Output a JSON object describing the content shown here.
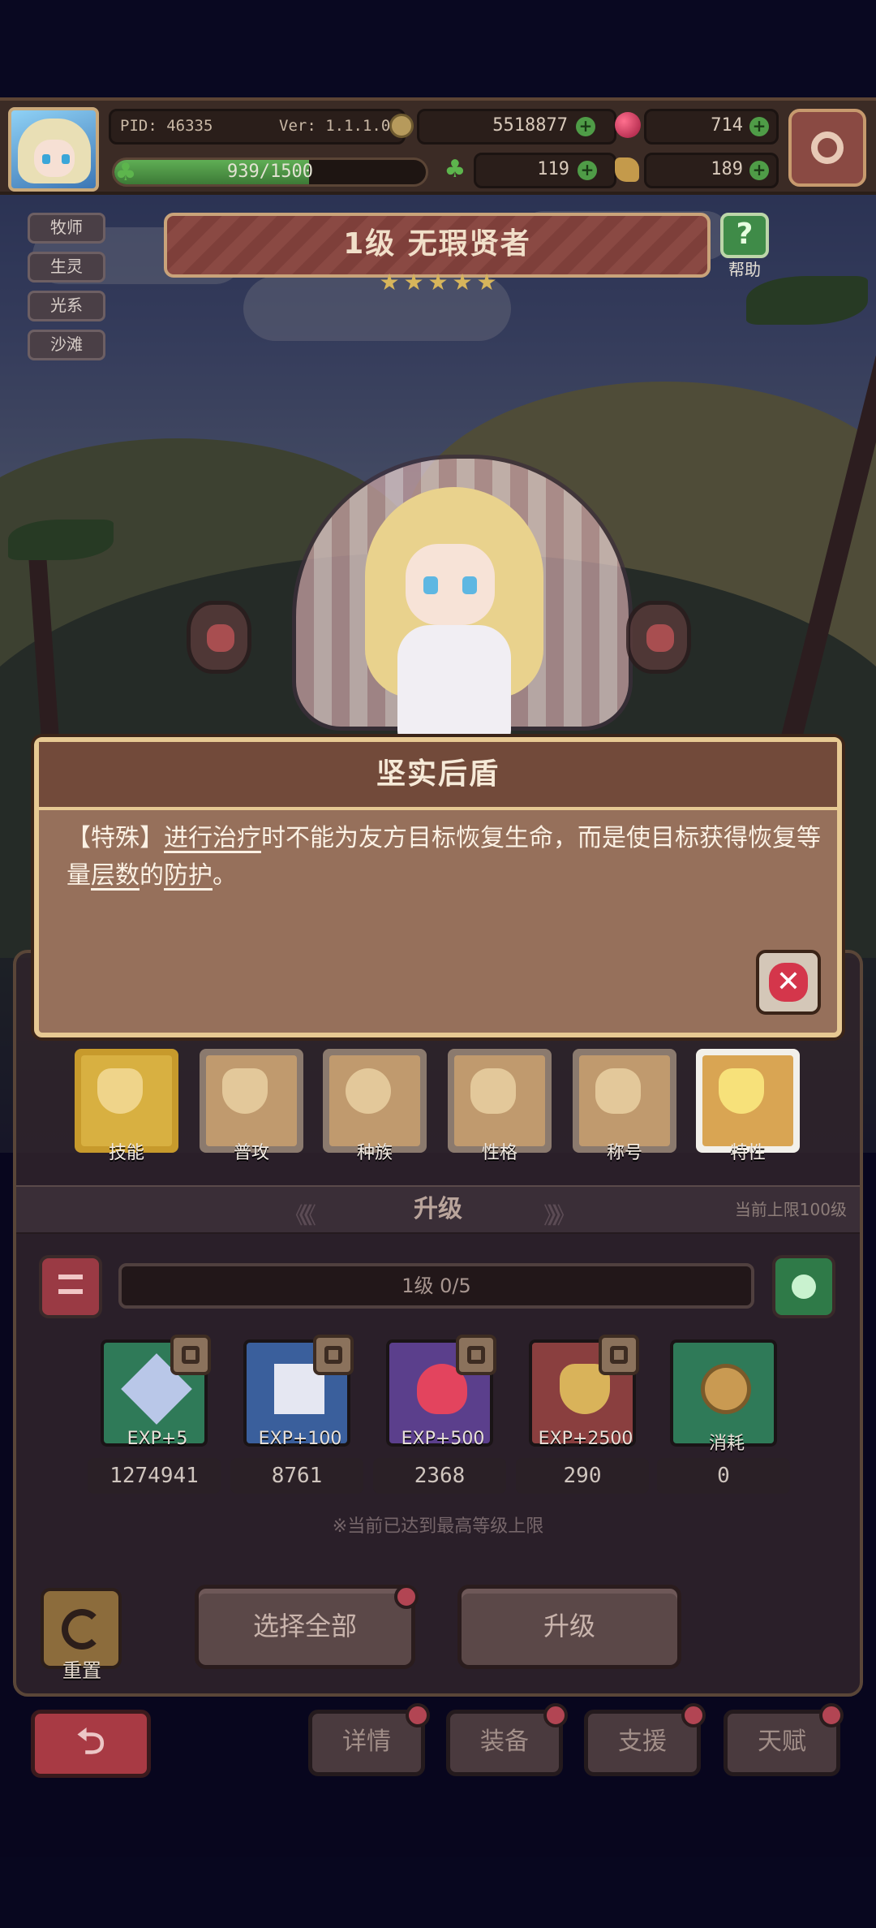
{
  "header": {
    "pid_label": "PID: 46335",
    "version_label": "Ver: 1.1.1.0",
    "gold": "5518877",
    "gems": "714",
    "clovers": "119",
    "keys": "189",
    "exp_text": "939/1500",
    "exp_progress": 0.626
  },
  "tags": [
    "牧师",
    "生灵",
    "光系",
    "沙滩"
  ],
  "hero": {
    "title": "1级  无瑕贤者",
    "stars": 5,
    "help_label": "帮助"
  },
  "popup": {
    "title": "坚实后盾",
    "prefix": "【特殊】",
    "kw1": "进行治疗",
    "mid1": "时不能为友方目标恢复生命，而是使目标获得恢复等量",
    "kw2": "层数",
    "mid2": "的",
    "kw3": "防护",
    "suffix": "。"
  },
  "categories": [
    {
      "label": "技能",
      "selected": false
    },
    {
      "label": "普攻",
      "selected": false
    },
    {
      "label": "种族",
      "selected": false
    },
    {
      "label": "性格",
      "selected": false
    },
    {
      "label": "称号",
      "selected": false
    },
    {
      "label": "特性",
      "selected": true
    }
  ],
  "levelup": {
    "title": "升级",
    "cap_text": "当前上限100级",
    "level_progress": "1级  0/5",
    "materials": [
      {
        "label": "EXP+5",
        "count": "1274941",
        "color": "#2f7a58"
      },
      {
        "label": "EXP+100",
        "count": "8761",
        "color": "#3a5f9c"
      },
      {
        "label": "EXP+500",
        "count": "2368",
        "color": "#5b3f8c"
      },
      {
        "label": "EXP+2500",
        "count": "290",
        "color": "#8a3f3f"
      },
      {
        "label": "消耗",
        "count": "0",
        "color": "#2f7a58"
      }
    ],
    "notice": "※当前已达到最高等级上限"
  },
  "actions": {
    "reset_label": "重置",
    "select_all_label": "选择全部",
    "upgrade_label": "升级"
  },
  "nav": {
    "details": "详情",
    "equipment": "装备",
    "support": "支援",
    "talent": "天赋"
  }
}
